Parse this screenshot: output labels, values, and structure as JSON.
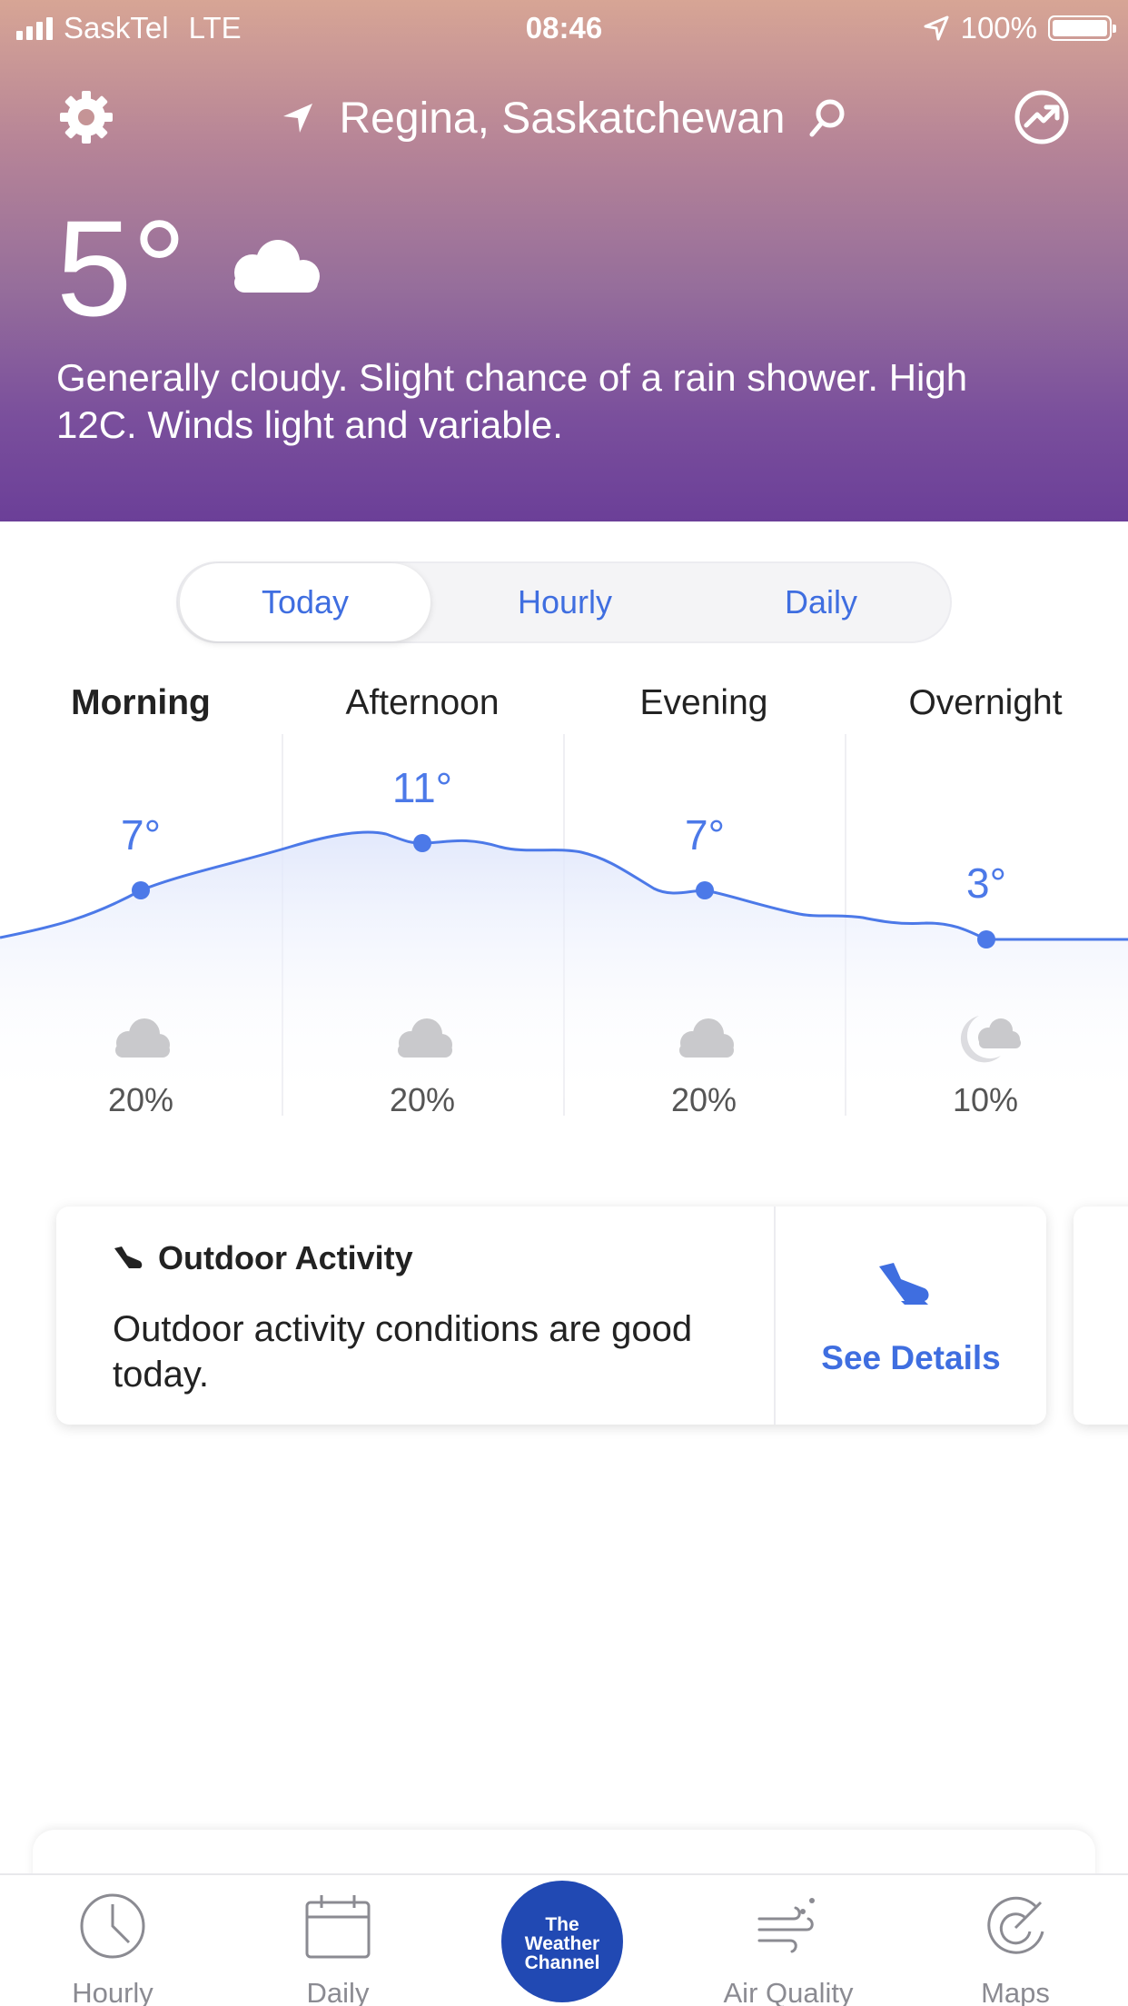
{
  "status_bar": {
    "carrier": "SaskTel",
    "network": "LTE",
    "time": "08:46",
    "battery": "100%"
  },
  "header": {
    "location": "Regina, Saskatchewan",
    "temperature": "5°",
    "condition_icon": "cloud-icon",
    "description": "Generally cloudy. Slight chance of a rain shower. High 12C. Winds light and variable."
  },
  "tabs": [
    {
      "label": "Today",
      "active": true
    },
    {
      "label": "Hourly",
      "active": false
    },
    {
      "label": "Daily",
      "active": false
    }
  ],
  "forecast": [
    {
      "period": "Morning",
      "temp": "7°",
      "precip": "20%",
      "icon": "cloud-icon",
      "bold": true
    },
    {
      "period": "Afternoon",
      "temp": "11°",
      "precip": "20%",
      "icon": "cloud-icon",
      "bold": false
    },
    {
      "period": "Evening",
      "temp": "7°",
      "precip": "20%",
      "icon": "cloud-icon",
      "bold": false
    },
    {
      "period": "Overnight",
      "temp": "3°",
      "precip": "10%",
      "icon": "moon-cloud-icon",
      "bold": false
    }
  ],
  "activity_card": {
    "title": "Outdoor Activity",
    "body": "Outdoor activity conditions are good today.",
    "link": "See Details"
  },
  "bottom_nav": {
    "hourly": "Hourly",
    "daily": "Daily",
    "brand_line1": "The",
    "brand_line2": "Weather",
    "brand_line3": "Channel",
    "air_quality": "Air Quality",
    "maps": "Maps"
  },
  "colors": {
    "accent": "#3f6ee0",
    "brand": "#2149b3",
    "header_top": "#d7a595",
    "header_bottom": "#6b3f98"
  }
}
